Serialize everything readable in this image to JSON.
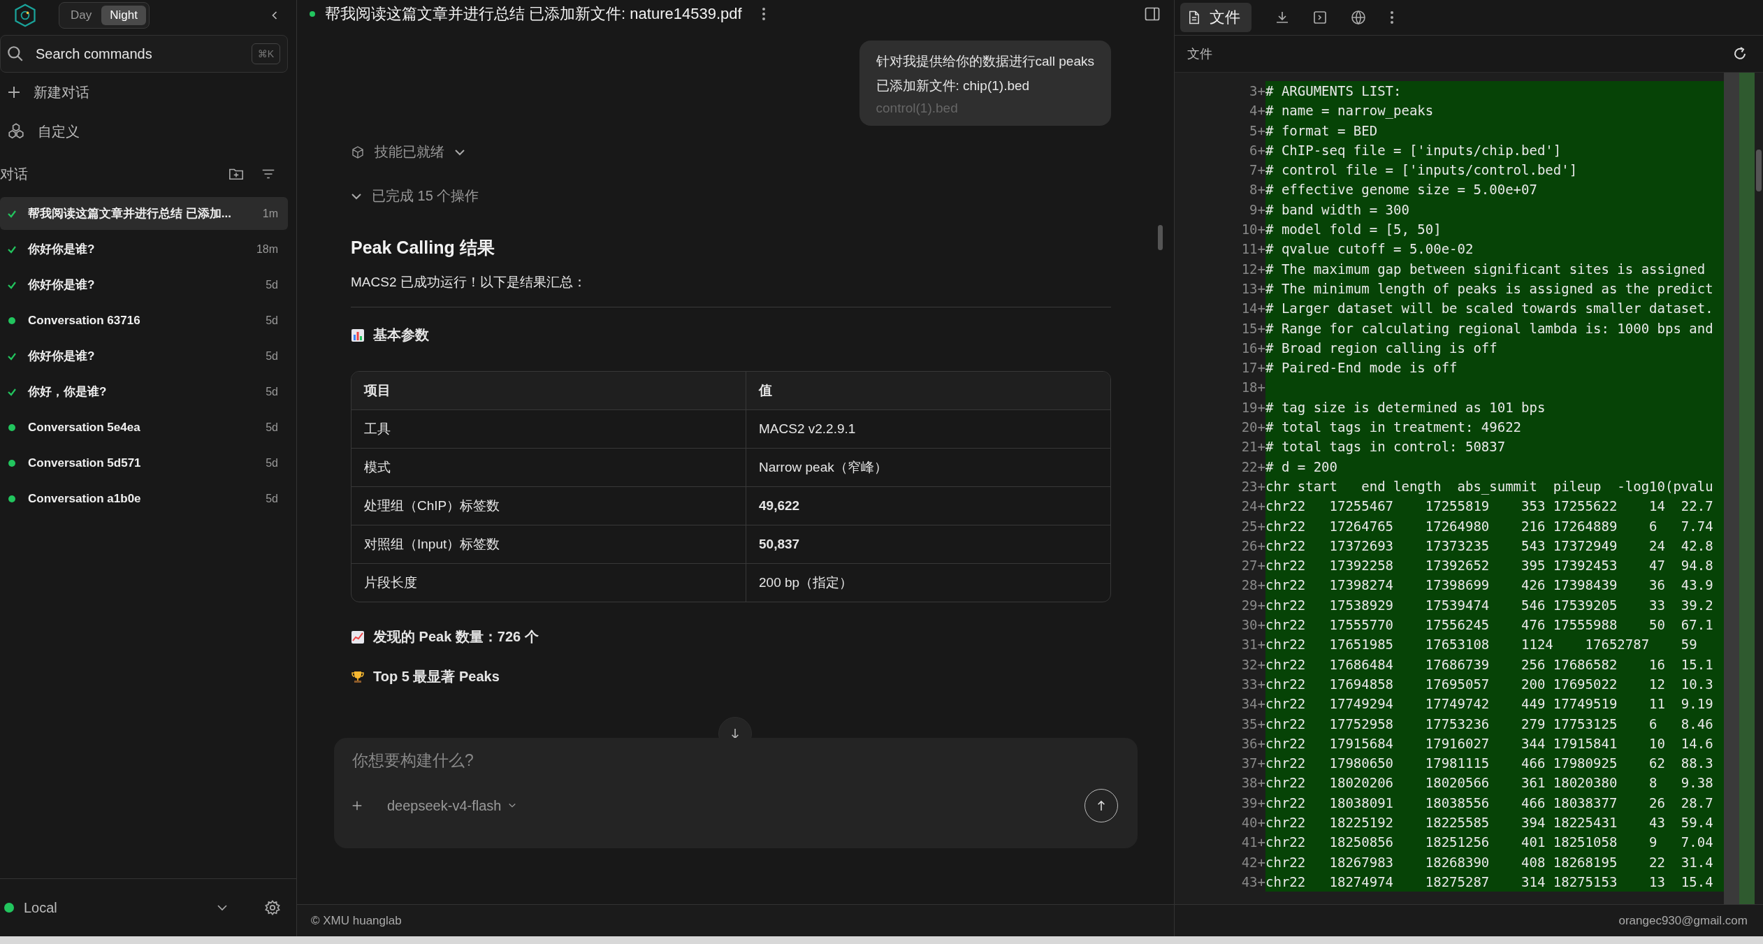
{
  "sidebar": {
    "theme_toggle": [
      {
        "label": "Day",
        "selected": false
      },
      {
        "label": "Night",
        "selected": true
      }
    ],
    "search": {
      "placeholder": "Search commands",
      "shortcut": "⌘K"
    },
    "actions": [
      {
        "kind": "new",
        "label": "新建对话"
      },
      {
        "kind": "custom",
        "label": "自定义"
      }
    ],
    "section_title": "对话",
    "conversations": [
      {
        "title": "帮我阅读这篇文章并进行总结 已添加...",
        "time": "1m",
        "kind": "done",
        "selected": true
      },
      {
        "title": "你好你是谁?",
        "time": "18m",
        "kind": "done",
        "selected": false
      },
      {
        "title": "你好你是谁?",
        "time": "5d",
        "kind": "done",
        "selected": false
      },
      {
        "title": "Conversation 63716",
        "time": "5d",
        "kind": "active",
        "selected": false
      },
      {
        "title": "你好你是谁?",
        "time": "5d",
        "kind": "done",
        "selected": false
      },
      {
        "title": "你好，你是谁?",
        "time": "5d",
        "kind": "done",
        "selected": false
      },
      {
        "title": "Conversation 5e4ea",
        "time": "5d",
        "kind": "active",
        "selected": false
      },
      {
        "title": "Conversation 5d571",
        "time": "5d",
        "kind": "active",
        "selected": false
      },
      {
        "title": "Conversation a1b0e",
        "time": "5d",
        "kind": "active",
        "selected": false
      }
    ],
    "workspace": {
      "label": "Local",
      "color": "#22c55e"
    }
  },
  "chat": {
    "title": "帮我阅读这篇文章并进行总结 已添加新文件: nature14539.pdf",
    "user_message": [
      "针对我提供给你的数据进行call peaks",
      "已添加新文件: chip(1).bed",
      "control(1).bed"
    ],
    "skills": "技能已就绪",
    "operations": "已完成 15 个操作",
    "heading": "Peak Calling 结果",
    "intro": "MACS2 已成功运行！以下是结果汇总：",
    "sections": [
      {
        "kind": "params",
        "text": "基本参数"
      }
    ],
    "table": {
      "columns": [
        "项目",
        "值"
      ],
      "rows": [
        {
          "item": "工具",
          "value": "MACS2 v2.2.9.1",
          "bold": false
        },
        {
          "item": "模式",
          "value": "Narrow peak（窄峰）",
          "bold": false
        },
        {
          "item": "处理组（ChIP）标签数",
          "value": "49,622",
          "bold": true
        },
        {
          "item": "对照组（Input）标签数",
          "value": "50,837",
          "bold": true
        },
        {
          "item": "片段长度",
          "value": "200 bp（指定）",
          "bold": false
        }
      ]
    },
    "after_table": [
      {
        "kind": "chart",
        "text": "发现的 Peak 数量：726 个"
      },
      {
        "kind": "trophy",
        "text": "Top 5 最显著 Peaks"
      }
    ],
    "composer": {
      "placeholder": "你想要构建什么?",
      "model": "deepseek-v4-flash"
    }
  },
  "file_panel": {
    "tabs": [
      {
        "label": "文件",
        "selected": true
      }
    ],
    "title": "文件",
    "lines": [
      {
        "number": "3",
        "marker": "+",
        "text": "# ARGUMENTS LIST:"
      },
      {
        "number": "4",
        "marker": "+",
        "text": "# name = narrow_peaks"
      },
      {
        "number": "5",
        "marker": "+",
        "text": "# format = BED"
      },
      {
        "number": "6",
        "marker": "+",
        "text": "# ChIP-seq file = ['inputs/chip.bed']"
      },
      {
        "number": "7",
        "marker": "+",
        "text": "# control file = ['inputs/control.bed']"
      },
      {
        "number": "8",
        "marker": "+",
        "text": "# effective genome size = 5.00e+07"
      },
      {
        "number": "9",
        "marker": "+",
        "text": "# band width = 300"
      },
      {
        "number": "10",
        "marker": "+",
        "text": "# model fold = [5, 50]"
      },
      {
        "number": "11",
        "marker": "+",
        "text": "# qvalue cutoff = 5.00e-02"
      },
      {
        "number": "12",
        "marker": "+",
        "text": "# The maximum gap between significant sites is assigned"
      },
      {
        "number": "13",
        "marker": "+",
        "text": "# The minimum length of peaks is assigned as the predict"
      },
      {
        "number": "14",
        "marker": "+",
        "text": "# Larger dataset will be scaled towards smaller dataset."
      },
      {
        "number": "15",
        "marker": "+",
        "text": "# Range for calculating regional lambda is: 1000 bps and"
      },
      {
        "number": "16",
        "marker": "+",
        "text": "# Broad region calling is off"
      },
      {
        "number": "17",
        "marker": "+",
        "text": "# Paired-End mode is off"
      },
      {
        "number": "18",
        "marker": "+"
      },
      {
        "number": "19",
        "marker": "+",
        "text": "# tag size is determined as 101 bps"
      },
      {
        "number": "20",
        "marker": "+",
        "text": "# total tags in treatment: 49622"
      },
      {
        "number": "21",
        "marker": "+",
        "text": "# total tags in control: 50837"
      },
      {
        "number": "22",
        "marker": "+",
        "text": "# d = 200"
      },
      {
        "number": "23",
        "marker": "+",
        "text": "chr start   end length  abs_summit  pileup  -log10(pvalu"
      },
      {
        "number": "24",
        "marker": "+",
        "text": "chr22   17255467    17255819    353 17255622    14  22.7"
      },
      {
        "number": "25",
        "marker": "+",
        "text": "chr22   17264765    17264980    216 17264889    6   7.74"
      },
      {
        "number": "26",
        "marker": "+",
        "text": "chr22   17372693    17373235    543 17372949    24  42.8"
      },
      {
        "number": "27",
        "marker": "+",
        "text": "chr22   17392258    17392652    395 17392453    47  94.8"
      },
      {
        "number": "28",
        "marker": "+",
        "text": "chr22   17398274    17398699    426 17398439    36  43.9"
      },
      {
        "number": "29",
        "marker": "+",
        "text": "chr22   17538929    17539474    546 17539205    33  39.2"
      },
      {
        "number": "30",
        "marker": "+",
        "text": "chr22   17555770    17556245    476 17555988    50  67.1"
      },
      {
        "number": "31",
        "marker": "+",
        "text": "chr22   17651985    17653108    1124    17652787    59"
      },
      {
        "number": "32",
        "marker": "+",
        "text": "chr22   17686484    17686739    256 17686582    16  15.1"
      },
      {
        "number": "33",
        "marker": "+",
        "text": "chr22   17694858    17695057    200 17695022    12  10.3"
      },
      {
        "number": "34",
        "marker": "+",
        "text": "chr22   17749294    17749742    449 17749519    11  9.19"
      },
      {
        "number": "35",
        "marker": "+",
        "text": "chr22   17752958    17753236    279 17753125    6   8.46"
      },
      {
        "number": "36",
        "marker": "+",
        "text": "chr22   17915684    17916027    344 17915841    10  14.6"
      },
      {
        "number": "37",
        "marker": "+",
        "text": "chr22   17980650    17981115    466 17980925    62  88.3"
      },
      {
        "number": "38",
        "marker": "+",
        "text": "chr22   18020206    18020566    361 18020380    8   9.38"
      },
      {
        "number": "39",
        "marker": "+",
        "text": "chr22   18038091    18038556    466 18038377    26  28.7"
      },
      {
        "number": "40",
        "marker": "+",
        "text": "chr22   18225192    18225585    394 18225431    43  59.4"
      },
      {
        "number": "41",
        "marker": "+",
        "text": "chr22   18250856    18251256    401 18251058    9   7.04"
      },
      {
        "number": "42",
        "marker": "+",
        "text": "chr22   18267983    18268390    408 18268195    22  31.4"
      },
      {
        "number": "43",
        "marker": "+",
        "text": "chr22   18274974    18275287    314 18275153    13  15.4"
      }
    ]
  },
  "status_bar": {
    "copyright": "© XMU huanglab",
    "user": "orangec930@gmail.com"
  }
}
